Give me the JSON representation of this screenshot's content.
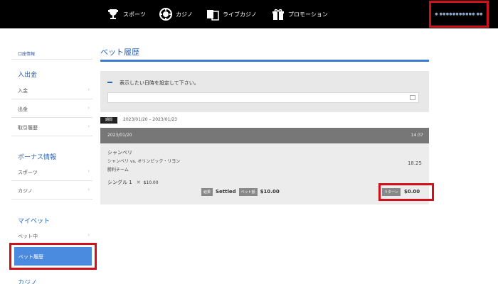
{
  "nav": {
    "sports": "スポーツ",
    "casino": "カジノ",
    "live_casino": "ライブカジノ",
    "promotions": "プロモーション"
  },
  "user": {
    "name": "● ●●●●●●●●●●● ●●"
  },
  "sidebar": {
    "top_link": "口座情報",
    "sections": [
      {
        "heading": "入出金",
        "items": [
          "入金",
          "出金",
          "取引履歴"
        ]
      },
      {
        "heading": "ボーナス情報",
        "items": [
          "スポーツ",
          "カジノ"
        ]
      },
      {
        "heading": "マイベット",
        "items": [
          "ベット中",
          "ベット履歴"
        ]
      },
      {
        "heading": "カジノ",
        "items": []
      }
    ],
    "active_item": "ベット履歴"
  },
  "main": {
    "title": "ベット履歴",
    "filter_label": "表示したい日時を設定して下さい。",
    "period_badge": "期間",
    "period_text": "2023/01/20 – 2023/01/23",
    "bet": {
      "date": "2023/01/20",
      "time": "14:37",
      "team": "シャンベリ",
      "match": "シャンベリ vs. オリンピック・リヨン",
      "market": "勝利チーム",
      "odds": "18.25",
      "bet_type": "シングル 1",
      "bet_amount": "$10.00",
      "status_tag": "結果",
      "status": "Settled",
      "stake_tag": "ベット額",
      "stake": "$10.00",
      "return_tag": "リターン",
      "return": "$0.00"
    }
  },
  "colors": {
    "accent": "#2a66b8",
    "highlight": "#d0101a",
    "active_bg": "#4a8be0"
  }
}
